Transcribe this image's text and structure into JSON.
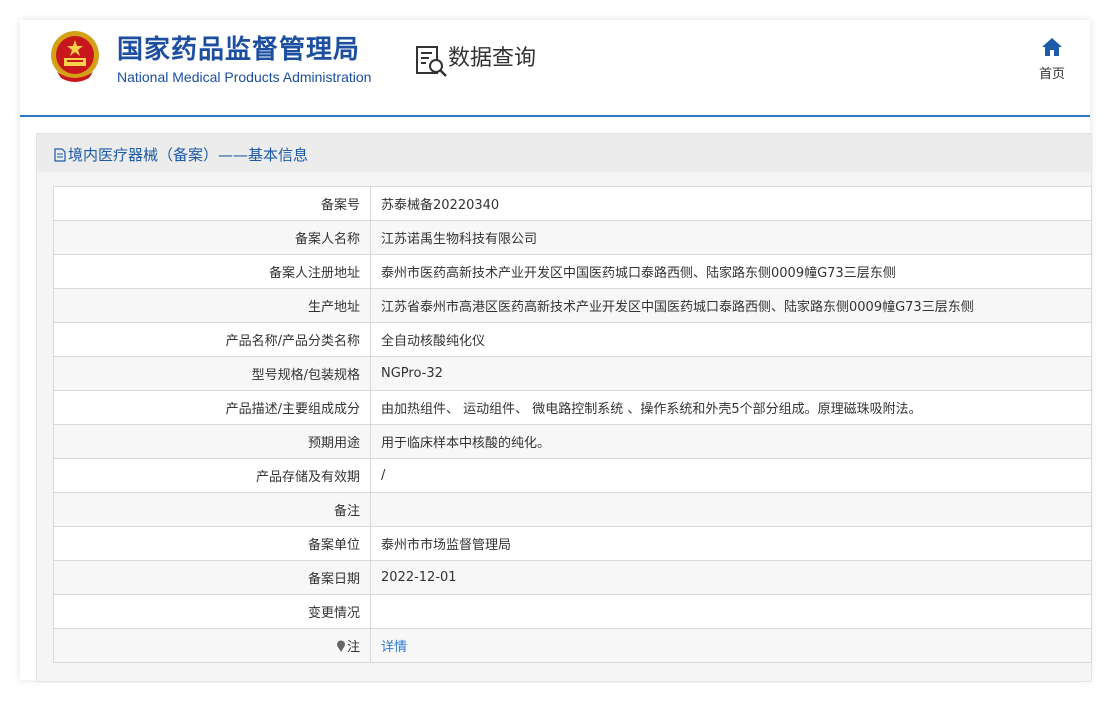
{
  "header": {
    "site_title": "国家药品监督管理局",
    "site_subtitle": "National Medical Products Administration",
    "query_title": "数据查询",
    "home_label": "首页"
  },
  "panel": {
    "title": "境内医疗器械（备案）——基本信息"
  },
  "rows": [
    {
      "label": "备案号",
      "value": "苏泰械备20220340"
    },
    {
      "label": "备案人名称",
      "value": "江苏诺禹生物科技有限公司"
    },
    {
      "label": "备案人注册地址",
      "value": "泰州市医药高新技术产业开发区中国医药城口泰路西侧、陆家路东侧0009幢G73三层东侧"
    },
    {
      "label": "生产地址",
      "value": "江苏省泰州市高港区医药高新技术产业开发区中国医药城口泰路西侧、陆家路东侧0009幢G73三层东侧"
    },
    {
      "label": "产品名称/产品分类名称",
      "value": "全自动核酸纯化仪"
    },
    {
      "label": "型号规格/包装规格",
      "value": "NGPro-32"
    },
    {
      "label": "产品描述/主要组成成分",
      "value": "由加热组件、 运动组件、 微电路控制系统 、操作系统和外壳5个部分组成。原理磁珠吸附法。"
    },
    {
      "label": "预期用途",
      "value": "用于临床样本中核酸的纯化。"
    },
    {
      "label": "产品存储及有效期",
      "value": "/"
    },
    {
      "label": "备注",
      "value": ""
    },
    {
      "label": "备案单位",
      "value": "泰州市市场监督管理局"
    },
    {
      "label": "备案日期",
      "value": "2022-12-01"
    },
    {
      "label": "变更情况",
      "value": ""
    },
    {
      "label": "注",
      "value": "详情"
    }
  ],
  "colors": {
    "brand_blue": "#1d4fa0",
    "header_rule": "#2f76c4",
    "link": "#2a7ad2"
  },
  "icons": {
    "emblem": "national-emblem-icon",
    "query": "document-search-icon",
    "home": "home-icon",
    "panel": "document-icon",
    "note": "pin-icon"
  }
}
